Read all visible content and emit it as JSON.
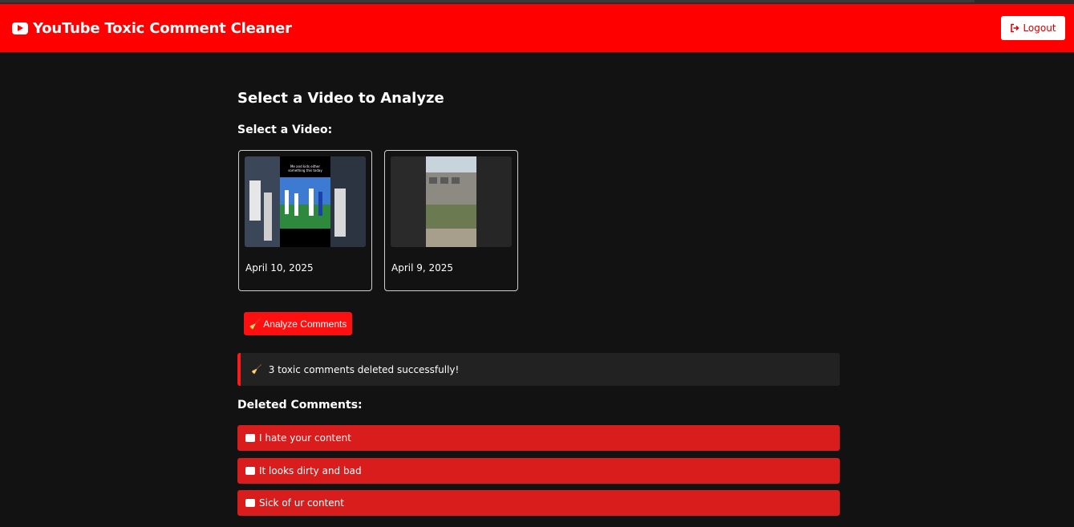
{
  "header": {
    "title": "YouTube Toxic Comment Cleaner",
    "logout_label": "Logout",
    "icon": "youtube-icon"
  },
  "main": {
    "page_title": "Select a Video to Analyze",
    "select_label": "Select a Video:",
    "videos": [
      {
        "date": "April 10, 2025",
        "thumb_caption": "Me and kids either ... something this today"
      },
      {
        "date": "April 9, 2025"
      }
    ],
    "analyze_label": "🧹 Analyze Comments",
    "alert": {
      "icon": "broom-icon",
      "text": "3 toxic comments deleted successfully!"
    },
    "deleted_title": "Deleted Comments:",
    "deleted_comments": [
      "I hate your content",
      "It looks dirty and bad",
      "Sick of ur content"
    ]
  },
  "colors": {
    "header_bg": "#ff0000",
    "page_bg": "#121212",
    "alert_bg": "#222222",
    "deleted_item_bg": "#d91c1c",
    "button_bg": "#ff1010"
  }
}
